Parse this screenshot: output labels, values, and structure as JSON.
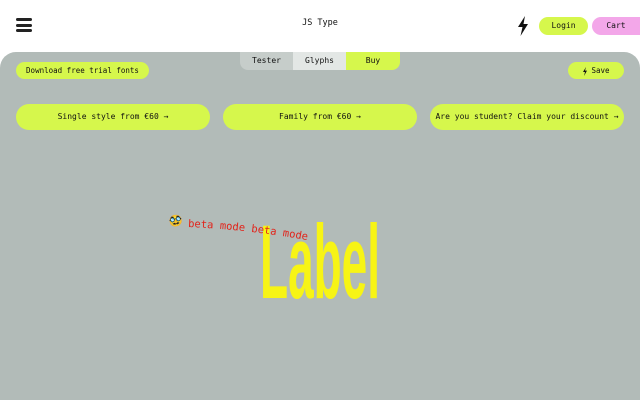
{
  "header": {
    "brand": "JS Type",
    "login_label": "Login",
    "cart_label": "Cart",
    "menu_icon": "hamburger-menu-icon",
    "bolt_icon": "lightning-bolt-icon"
  },
  "tabs": [
    {
      "label": "Tester"
    },
    {
      "label": "Glyphs"
    },
    {
      "label": "Buy"
    }
  ],
  "actions": {
    "download_label": "Download free trial fonts",
    "save_label": "Save"
  },
  "offers": [
    {
      "label": "Single style from €60 →"
    },
    {
      "label": "Family from €60 →"
    },
    {
      "label": "Are you student? Claim your discount →"
    }
  ],
  "specimen": {
    "text": "Label",
    "color": "#f7f415"
  },
  "badge": {
    "emoji": "🥸",
    "text": "beta mode beta mode",
    "color": "#e2231a"
  },
  "colors": {
    "accent": "#d6f74c",
    "cart": "#f3a7e9",
    "panel": "#b2bbb8"
  }
}
